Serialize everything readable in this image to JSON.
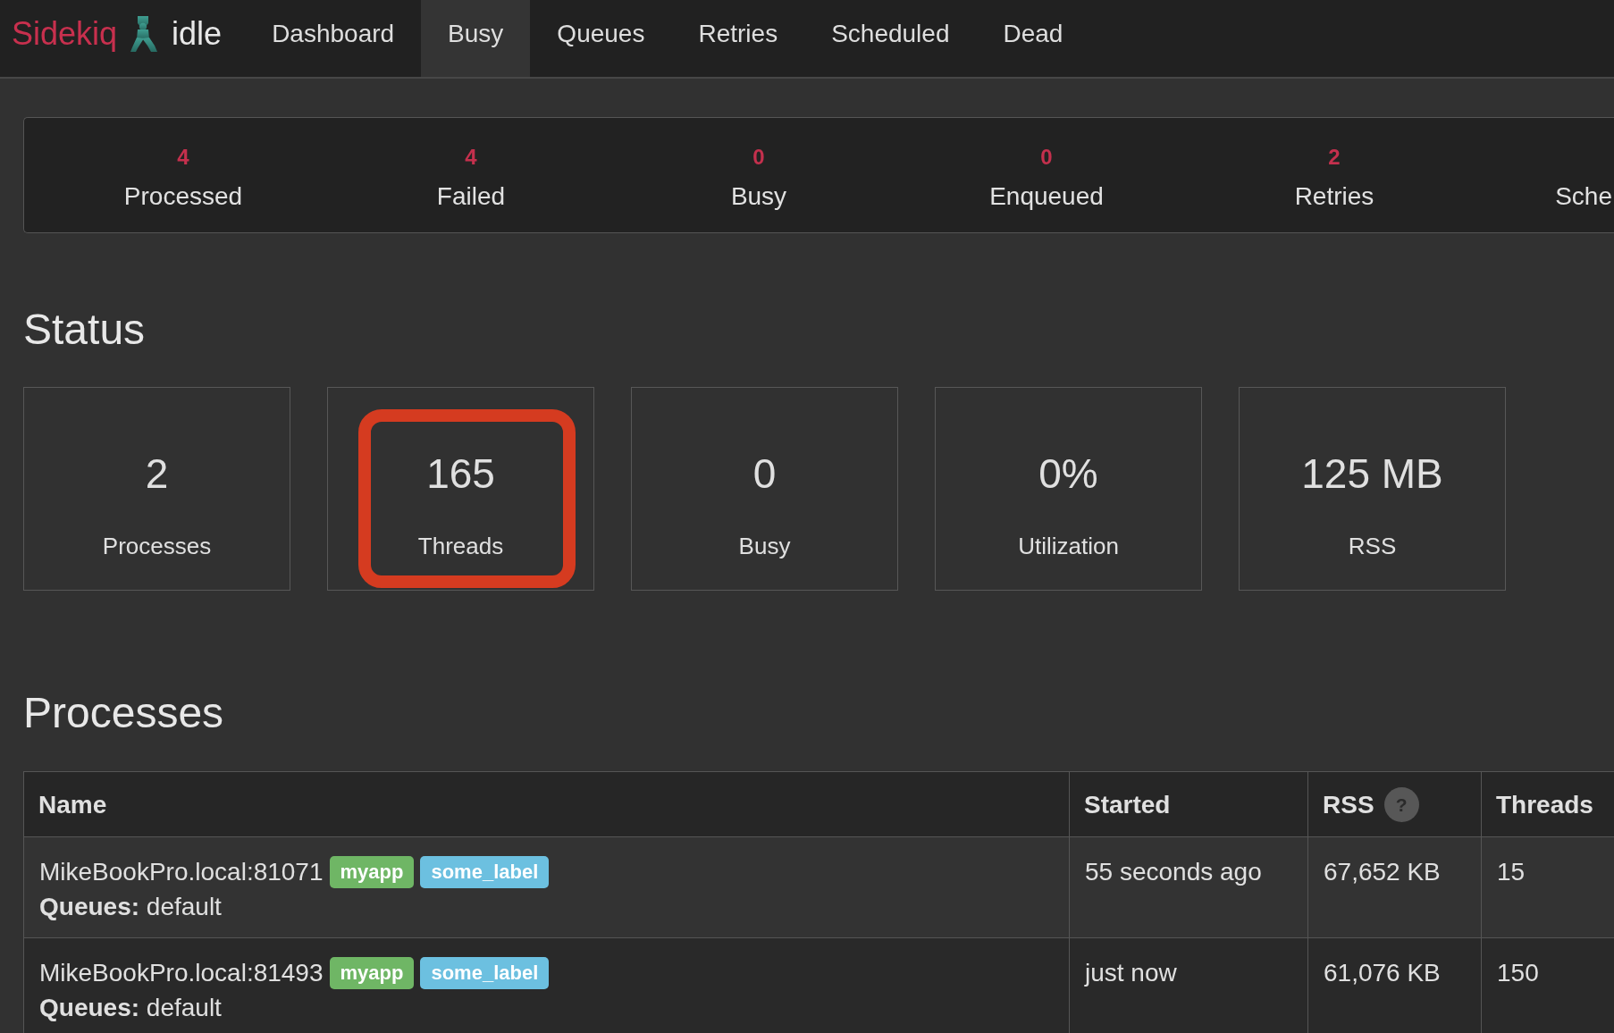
{
  "navbar": {
    "brand": "Sidekiq",
    "status": "idle",
    "tabs": [
      {
        "label": "Dashboard",
        "selected": false
      },
      {
        "label": "Busy",
        "selected": true
      },
      {
        "label": "Queues",
        "selected": false
      },
      {
        "label": "Retries",
        "selected": false
      },
      {
        "label": "Scheduled",
        "selected": false
      },
      {
        "label": "Dead",
        "selected": false
      }
    ]
  },
  "summary": [
    {
      "value": "4",
      "label": "Processed"
    },
    {
      "value": "4",
      "label": "Failed"
    },
    {
      "value": "0",
      "label": "Busy"
    },
    {
      "value": "0",
      "label": "Enqueued"
    },
    {
      "value": "2",
      "label": "Retries"
    },
    {
      "label": "Sche"
    }
  ],
  "status": {
    "title": "Status",
    "cards": [
      {
        "value": "2",
        "label": "Processes",
        "highlighted": false
      },
      {
        "value": "165",
        "label": "Threads",
        "highlighted": true
      },
      {
        "value": "0",
        "label": "Busy",
        "highlighted": false
      },
      {
        "value": "0%",
        "label": "Utilization",
        "highlighted": false
      },
      {
        "value": "125 MB",
        "label": "RSS",
        "highlighted": false
      }
    ]
  },
  "processes": {
    "title": "Processes",
    "columns": [
      {
        "label": "Name"
      },
      {
        "label": "Started"
      },
      {
        "label": "RSS",
        "help": "?"
      },
      {
        "label": "Threads"
      }
    ],
    "rows": [
      {
        "name": "MikeBookPro.local:81071",
        "tags": [
          {
            "text": "myapp",
            "color": "#6fb665"
          },
          {
            "text": "some_label",
            "color": "#6cc0e0"
          }
        ],
        "queues": "**Queues:** default",
        "started": "55 seconds ago",
        "rss": "67,652 KB",
        "threads": "15"
      },
      {
        "name": "MikeBookPro.local:81493",
        "tags": [
          {
            "text": "myapp",
            "color": "#6fb665"
          },
          {
            "text": "some_label",
            "color": "#6cc0e0"
          }
        ],
        "queues": "**Queues:** default",
        "started": "just now",
        "rss": "61,076 KB",
        "threads": "150"
      }
    ]
  }
}
